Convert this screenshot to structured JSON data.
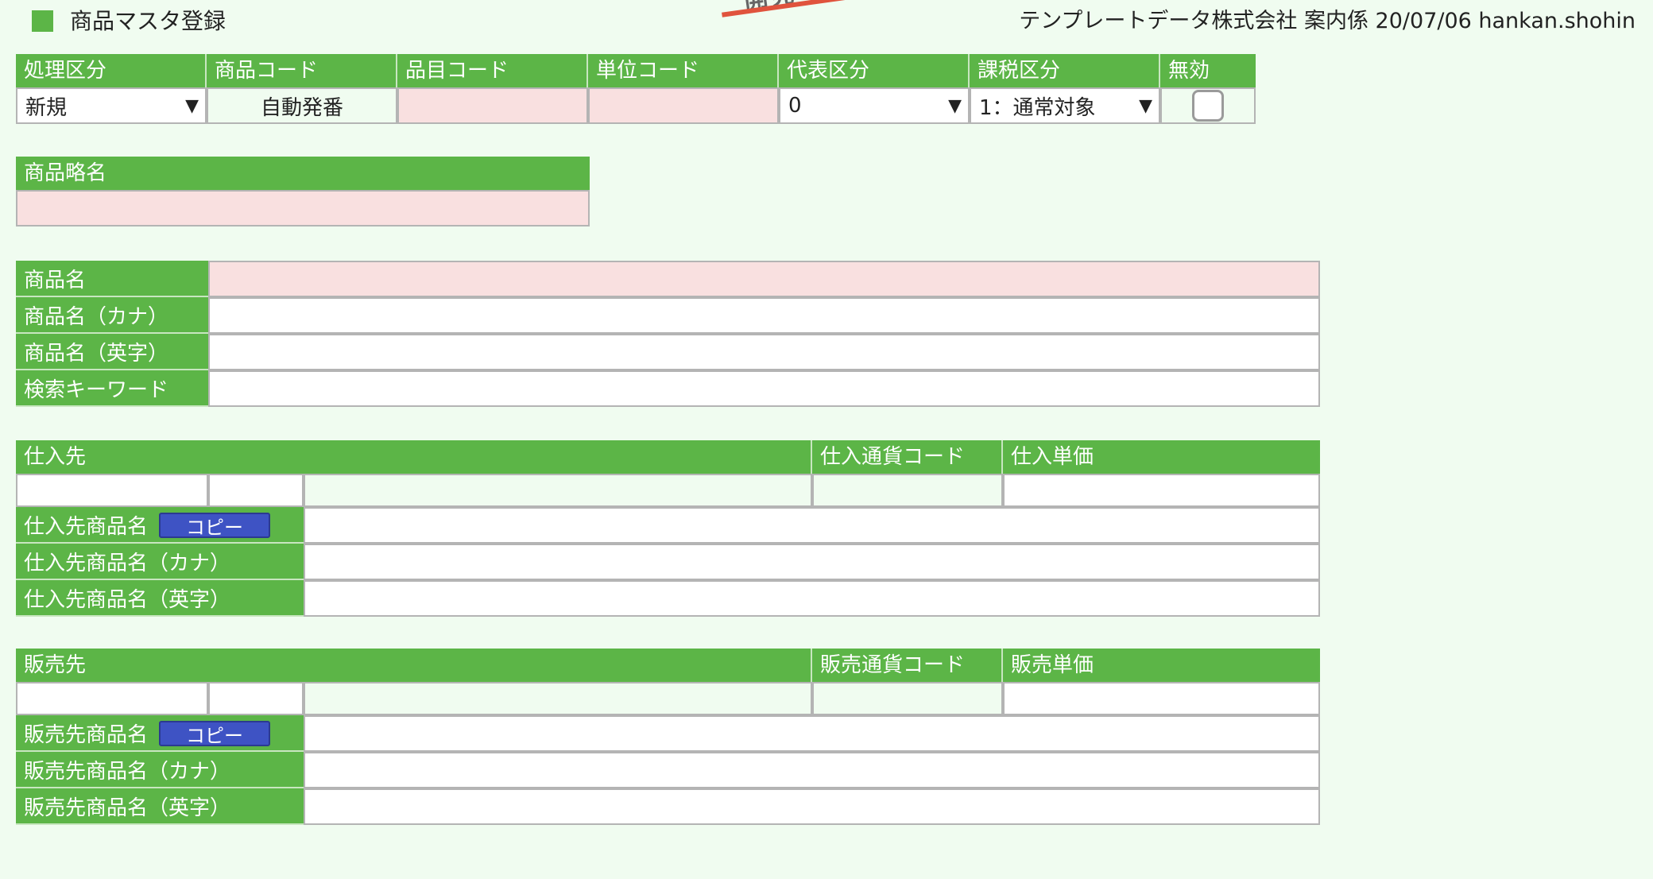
{
  "header": {
    "title": "商品マスタ登録",
    "stamp": "開発",
    "user_info": "テンプレートデータ株式会社 案内係 20/07/06 hankan.shohin",
    "accent_color": "#5cb547"
  },
  "top_row": {
    "labels": [
      "処理区分",
      "商品コード",
      "品目コード",
      "単位コード",
      "代表区分",
      "課税区分",
      "無効"
    ],
    "process_value": "新規",
    "product_code_value": "自動発番",
    "rep_value": "0",
    "tax_value": "1：通常対象"
  },
  "short_name": {
    "label": "商品略名"
  },
  "names": {
    "labels": [
      "商品名",
      "商品名（カナ）",
      "商品名（英字）",
      "検索キーワード"
    ]
  },
  "supplier": {
    "label": "仕入先",
    "currency_label": "仕入通貨コード",
    "price_label": "仕入単価",
    "copy_label": "コピー",
    "rows": [
      "仕入先商品名",
      "仕入先商品名（カナ）",
      "仕入先商品名（英字）"
    ]
  },
  "customer": {
    "label": "販売先",
    "currency_label": "販売通貨コード",
    "price_label": "販売単価",
    "copy_label": "コピー",
    "rows": [
      "販売先商品名",
      "販売先商品名（カナ）",
      "販売先商品名（英字）"
    ]
  }
}
